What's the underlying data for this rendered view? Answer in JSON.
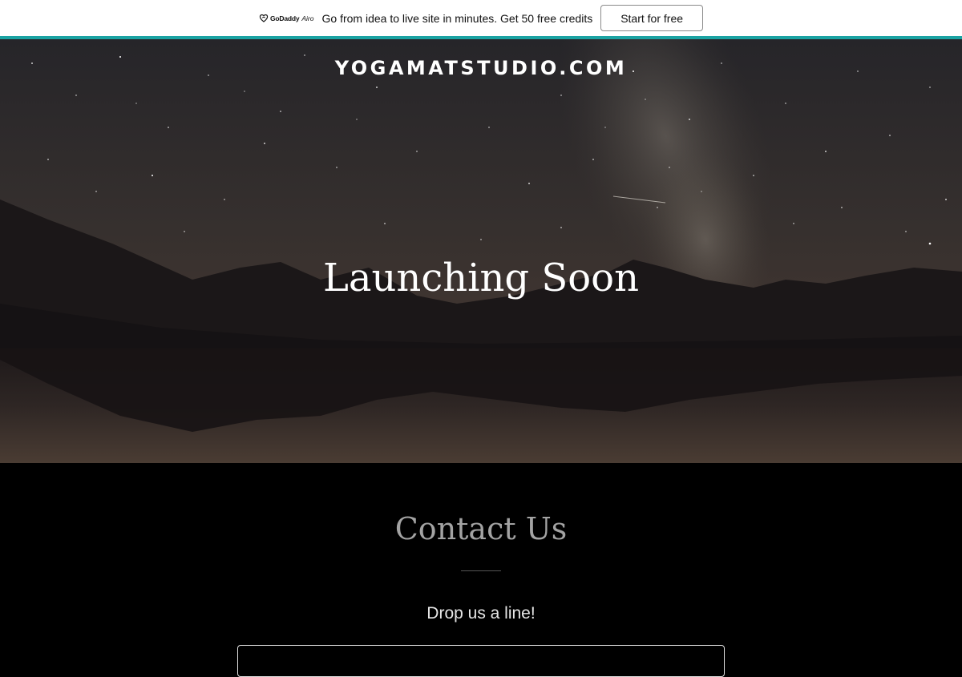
{
  "promo": {
    "logo_text": "GoDaddy",
    "logo_sub": "Airo",
    "message": "Go from idea to live site in minutes. Get 50 free credits",
    "button_label": "Start for free",
    "accent_color": "#1ba3a3"
  },
  "hero": {
    "site_title": "YOGAMATSTUDIO.COM",
    "heading": "Launching Soon"
  },
  "contact": {
    "heading": "Contact Us",
    "subheading": "Drop us a line!"
  },
  "icons": {
    "brand": "godaddy-logo-icon"
  }
}
